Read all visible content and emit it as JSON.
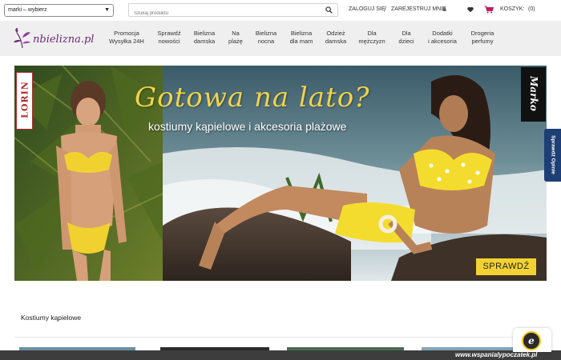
{
  "header": {
    "brand_select": "marki – wybierz",
    "search_placeholder": "Szukaj produktu",
    "login": "ZALOGUJ SIĘ",
    "separator": "/",
    "register": "ZAREJESTRUJ MNIE",
    "cart_label": "KOSZYK:",
    "cart_count": "(0)"
  },
  "logo": {
    "text": "nbielizna.pl"
  },
  "nav": {
    "items": [
      {
        "line1": "Promocja",
        "line2": "Wysyłka 24H"
      },
      {
        "line1": "Sprawdź",
        "line2": "nowości"
      },
      {
        "line1": "Bielizna",
        "line2": "damska"
      },
      {
        "line1": "Na",
        "line2": "plażę"
      },
      {
        "line1": "Bielizna",
        "line2": "nocna"
      },
      {
        "line1": "Bielizna",
        "line2": "dla mam"
      },
      {
        "line1": "Odzież",
        "line2": "damska"
      },
      {
        "line1": "Dla",
        "line2": "mężczyzn"
      },
      {
        "line1": "Dla",
        "line2": "dzieci"
      },
      {
        "line1": "Dodatki",
        "line2": "i akcesoria"
      },
      {
        "line1": "Drogeria",
        "line2": "perfumy"
      }
    ]
  },
  "hero": {
    "headline": "Gotowa na lato?",
    "subline": "kostiumy kąpielowe i akcesoria plażowe",
    "brand_left": "LORIN",
    "brand_right": "Marko",
    "cta": "SPRAWDŹ",
    "accent_color": "#f2d232"
  },
  "opinions_tab": "Sprawdź Opinie",
  "section": {
    "title": "Kostiumy kąpielowe"
  },
  "trust_badge": "e",
  "watermark": "www.wspanialypoczatek.pl"
}
